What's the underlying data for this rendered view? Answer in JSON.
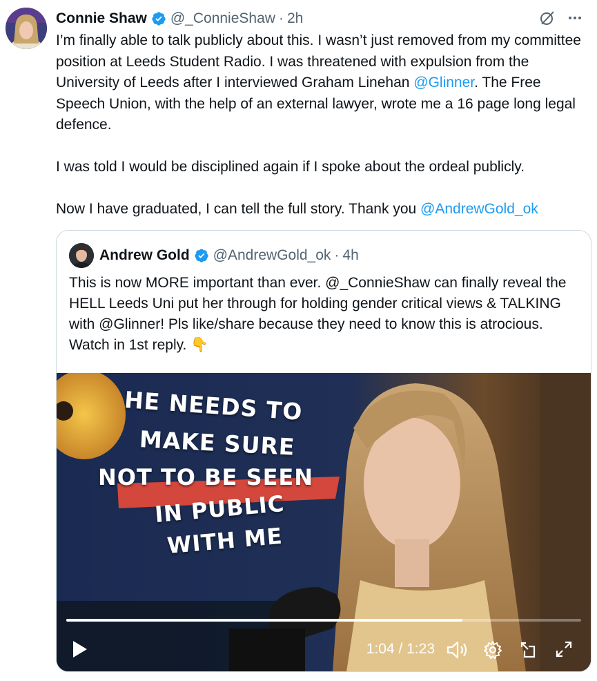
{
  "tweet": {
    "author_name": "Connie Shaw",
    "handle": "@_ConnieShaw",
    "separator": "·",
    "time": "2h",
    "text_p1a": "I’m finally able to talk publicly about this. I wasn’t just removed from my committee position at Leeds Student Radio. I was threatened with expulsion from the University of Leeds after I interviewed Graham Linehan ",
    "mention1": "@Glinner",
    "text_p1b": ". The Free Speech Union, with the help of an external lawyer, wrote me a 16 page long legal defence.",
    "text_p2": "I was told I would be disciplined again if I spoke about the ordeal publicly.",
    "text_p3": "Now I have graduated, I can tell the full story. Thank you ",
    "mention2": "@AndrewGold_ok"
  },
  "icons": {
    "verified": "verified-badge-icon",
    "grok": "grok-icon",
    "more": "more-icon",
    "play": "play-icon",
    "volume": "volume-icon",
    "settings": "gear-icon",
    "popout": "popout-icon",
    "fullscreen": "fullscreen-icon"
  },
  "quote": {
    "author_name": "Andrew Gold",
    "handle": "@AndrewGold_ok",
    "separator": "·",
    "time": "4h",
    "text": "This is now MORE important than ever. @_ConnieShaw can finally reveal the HELL Leeds Uni put her through for holding gender critical views & TALKING with @Glinner! Pls like/share because they need to know this is atrocious. Watch in 1st reply. ",
    "emoji": "👇"
  },
  "video": {
    "overlay_lines": [
      "HE NEEDS TO",
      "MAKE SURE",
      "NOT TO BE SEEN",
      "IN PUBLIC",
      "WITH ME"
    ],
    "timecode": "1:04 / 1:23",
    "progress": 0.77
  },
  "colors": {
    "mention": "#1d9bf0",
    "verified": "#1d9bf0",
    "secondary_text": "#536471"
  }
}
